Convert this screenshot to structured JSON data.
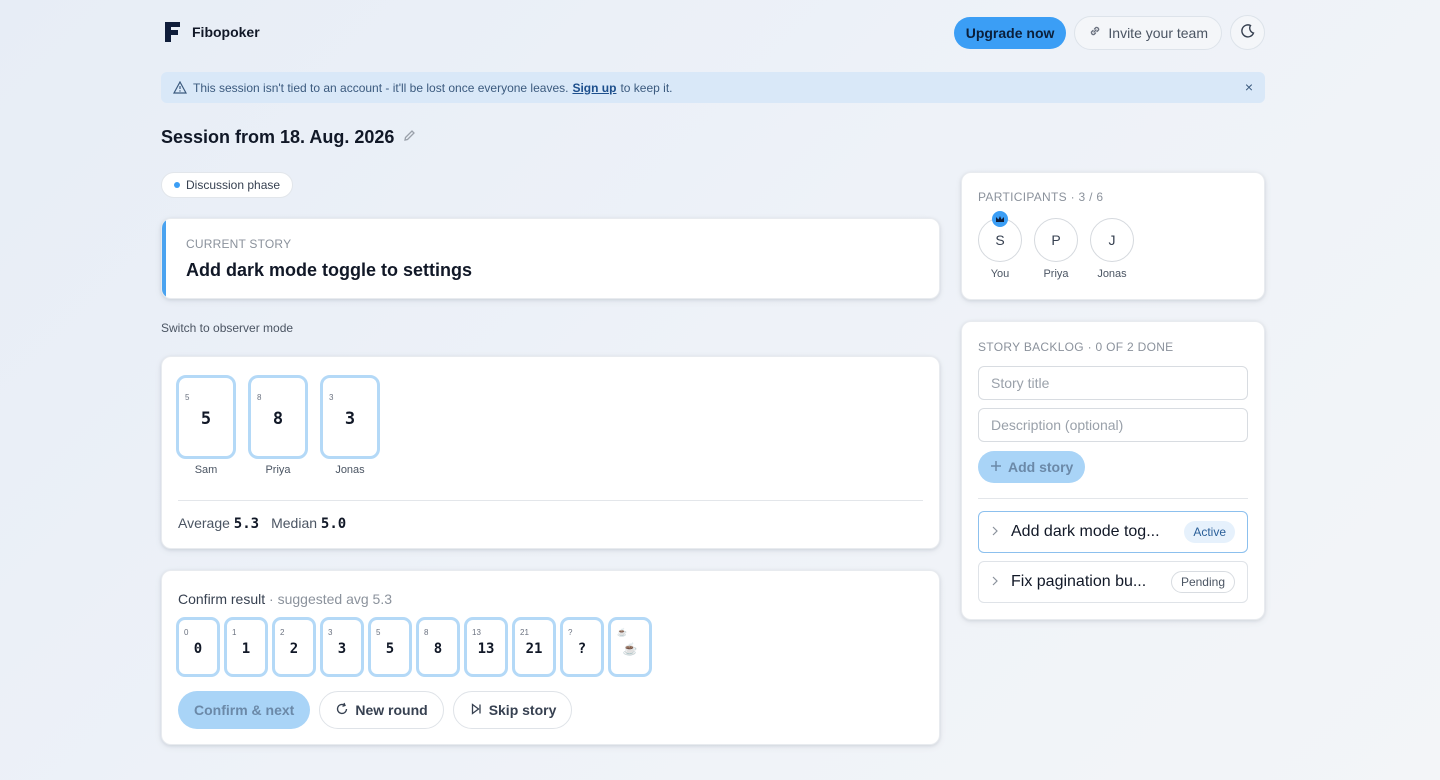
{
  "colors": {
    "accent": "#3b9ef5",
    "card_border": "#b4d9f7",
    "banner_bg": "#d9e8f8"
  },
  "header": {
    "brand": "Fibopoker",
    "upgrade_label": "Upgrade now",
    "invite_label": "Invite your team",
    "theme_icon": "moon-icon"
  },
  "banner": {
    "text_before": "This session isn't tied to an account - it'll be lost once everyone leaves.",
    "link": "Sign up",
    "text_after": "to keep it.",
    "close": "×"
  },
  "session": {
    "title": "Session from 18. Aug. 2026",
    "phase": "Discussion phase"
  },
  "story": {
    "eyebrow": "CURRENT STORY",
    "title": "Add dark mode toggle to settings"
  },
  "observer_link": "Switch to observer mode",
  "votes": [
    {
      "corner": "5",
      "value": "5",
      "name": "Sam"
    },
    {
      "corner": "8",
      "value": "8",
      "name": "Priya"
    },
    {
      "corner": "3",
      "value": "3",
      "name": "Jonas"
    }
  ],
  "stats": {
    "average_label": "Average",
    "average": "5.3",
    "median_label": "Median",
    "median": "5.0"
  },
  "confirm": {
    "heading": "Confirm result",
    "suggestion": "· suggested avg 5.3",
    "cards": [
      "0",
      "1",
      "2",
      "3",
      "5",
      "8",
      "13",
      "21",
      "?"
    ],
    "coffee_icon": "coffee-cup-icon",
    "confirm_label": "Confirm & next",
    "new_round_label": "New round",
    "skip_label": "Skip story"
  },
  "participants": {
    "heading": "PARTICIPANTS · 3 / 6",
    "people": [
      {
        "initial": "S",
        "name": "You"
      },
      {
        "initial": "P",
        "name": "Priya"
      },
      {
        "initial": "J",
        "name": "Jonas"
      }
    ]
  },
  "backlog": {
    "heading": "STORY BACKLOG · 0 OF 2 DONE",
    "title_placeholder": "Story title",
    "desc_placeholder": "Description (optional)",
    "add_label": "Add story",
    "items": [
      {
        "title": "Add dark mode tog...",
        "status": "Active"
      },
      {
        "title": "Fix pagination bu...",
        "status": "Pending"
      }
    ]
  }
}
